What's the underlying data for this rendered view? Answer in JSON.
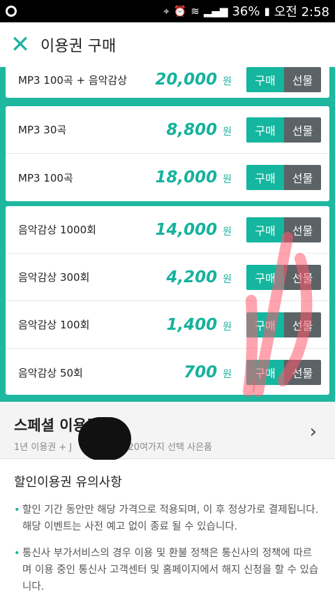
{
  "status": {
    "battery": "36%",
    "time": "오전 2:58"
  },
  "header": {
    "title": "이용권 구매"
  },
  "buttons": {
    "buy": "구매",
    "gift": "선물"
  },
  "currency": "원",
  "groups": [
    {
      "items": [
        {
          "name": "MP3 100곡 + 음악감상",
          "price": "20,000"
        }
      ]
    },
    {
      "items": [
        {
          "name": "MP3 30곡",
          "price": "8,800"
        },
        {
          "name": "MP3 100곡",
          "price": "18,000"
        }
      ]
    },
    {
      "items": [
        {
          "name": "음악감상 1000회",
          "price": "14,000"
        },
        {
          "name": "음악감상 300회",
          "price": "4,200"
        },
        {
          "name": "음악감상 100회",
          "price": "1,400"
        },
        {
          "name": "음악감상 50회",
          "price": "700"
        }
      ]
    }
  ],
  "special": {
    "title": "스페셜 이용권",
    "subtitle": "1년 이용권 + J",
    "subtitle_tail": "20여가지 선택 사은품"
  },
  "notice": {
    "title": "할인이용권 유의사항",
    "items": [
      "할인 기간 동안만 해당 가격으로 적용되며, 이 후 정상가로 결제됩니다. 해당 이벤트는 사전 예고 없이 종료 될 수 있습니다.",
      "통신사 부가서비스의 경우 이용 및 환불 정책은 통신사의 정책에 따르며 이용 중인 통신사 고객센터 및 홈페이지에서 해지 신청을 할 수 있습니다."
    ]
  }
}
